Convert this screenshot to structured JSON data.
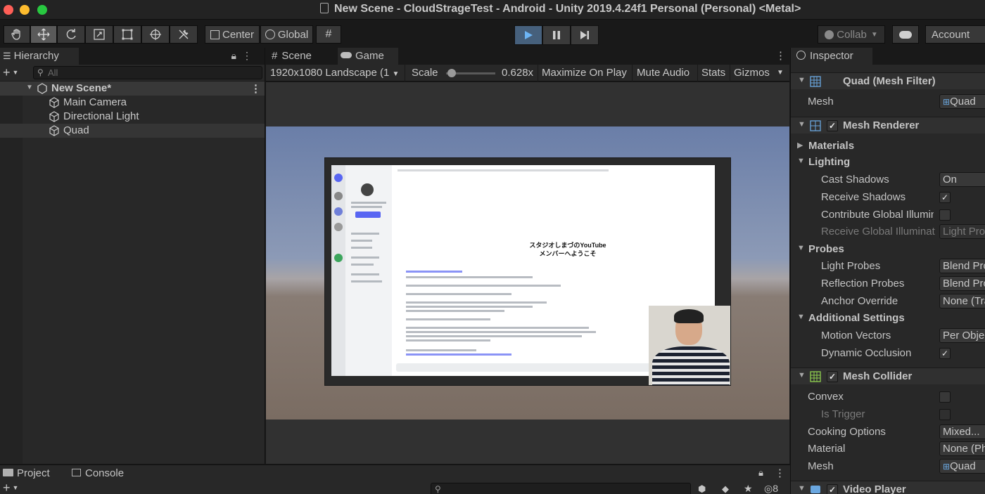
{
  "window": {
    "title": "New Scene - CloudStrageTest - Android - Unity 2019.4.24f1 Personal (Personal) <Metal>"
  },
  "toolbar": {
    "pivot_label": "Center",
    "space_label": "Global",
    "collab_label": "Collab",
    "account_label": "Account"
  },
  "hierarchy": {
    "tab_label": "Hierarchy",
    "search_placeholder": "All",
    "scene_name": "New Scene*",
    "items": [
      "Main Camera",
      "Directional Light",
      "Quad"
    ]
  },
  "game": {
    "scene_tab": "Scene",
    "game_tab": "Game",
    "resolution": "1920x1080 Landscape (1",
    "scale_label": "Scale",
    "scale_value": "0.628x",
    "scale_fraction": 0.06,
    "maximize_label": "Maximize On Play",
    "mute_label": "Mute Audio",
    "stats_label": "Stats",
    "gizmos_label": "Gizmos",
    "welcome_line1": "スタジオしまづのYouTube",
    "welcome_line2": "メンバーへようこそ"
  },
  "inspector": {
    "tab_label": "Inspector",
    "mesh_filter": {
      "header": "Quad (Mesh Filter)",
      "mesh_label": "Mesh",
      "mesh_value": "Quad"
    },
    "mesh_renderer": {
      "header": "Mesh Renderer",
      "materials": "Materials",
      "lighting": "Lighting",
      "cast_shadows_label": "Cast Shadows",
      "cast_shadows_value": "On",
      "receive_shadows_label": "Receive Shadows",
      "contribute_gi_label": "Contribute Global Illumin",
      "receive_gi_label": "Receive Global Illuminat",
      "receive_gi_value": "Light Pro",
      "probes": "Probes",
      "light_probes_label": "Light Probes",
      "light_probes_value": "Blend Pro",
      "reflection_probes_label": "Reflection Probes",
      "reflection_probes_value": "Blend Pro",
      "anchor_label": "Anchor Override",
      "anchor_value": "None (Tra",
      "additional": "Additional Settings",
      "motion_vectors_label": "Motion Vectors",
      "motion_vectors_value": "Per Objec",
      "dynamic_occlusion_label": "Dynamic Occlusion"
    },
    "mesh_collider": {
      "header": "Mesh Collider",
      "convex_label": "Convex",
      "is_trigger_label": "Is Trigger",
      "cooking_label": "Cooking Options",
      "cooking_value": "Mixed...",
      "material_label": "Material",
      "material_value": "None (Ph",
      "mesh_label": "Mesh",
      "mesh_value": "Quad"
    },
    "video_player": {
      "header": "Video Player"
    }
  },
  "bottom": {
    "project_tab": "Project",
    "console_tab": "Console",
    "hidden_count": "8"
  },
  "colors": {
    "play_active": "#46607c",
    "selection": "#383838",
    "panel": "#282828"
  }
}
